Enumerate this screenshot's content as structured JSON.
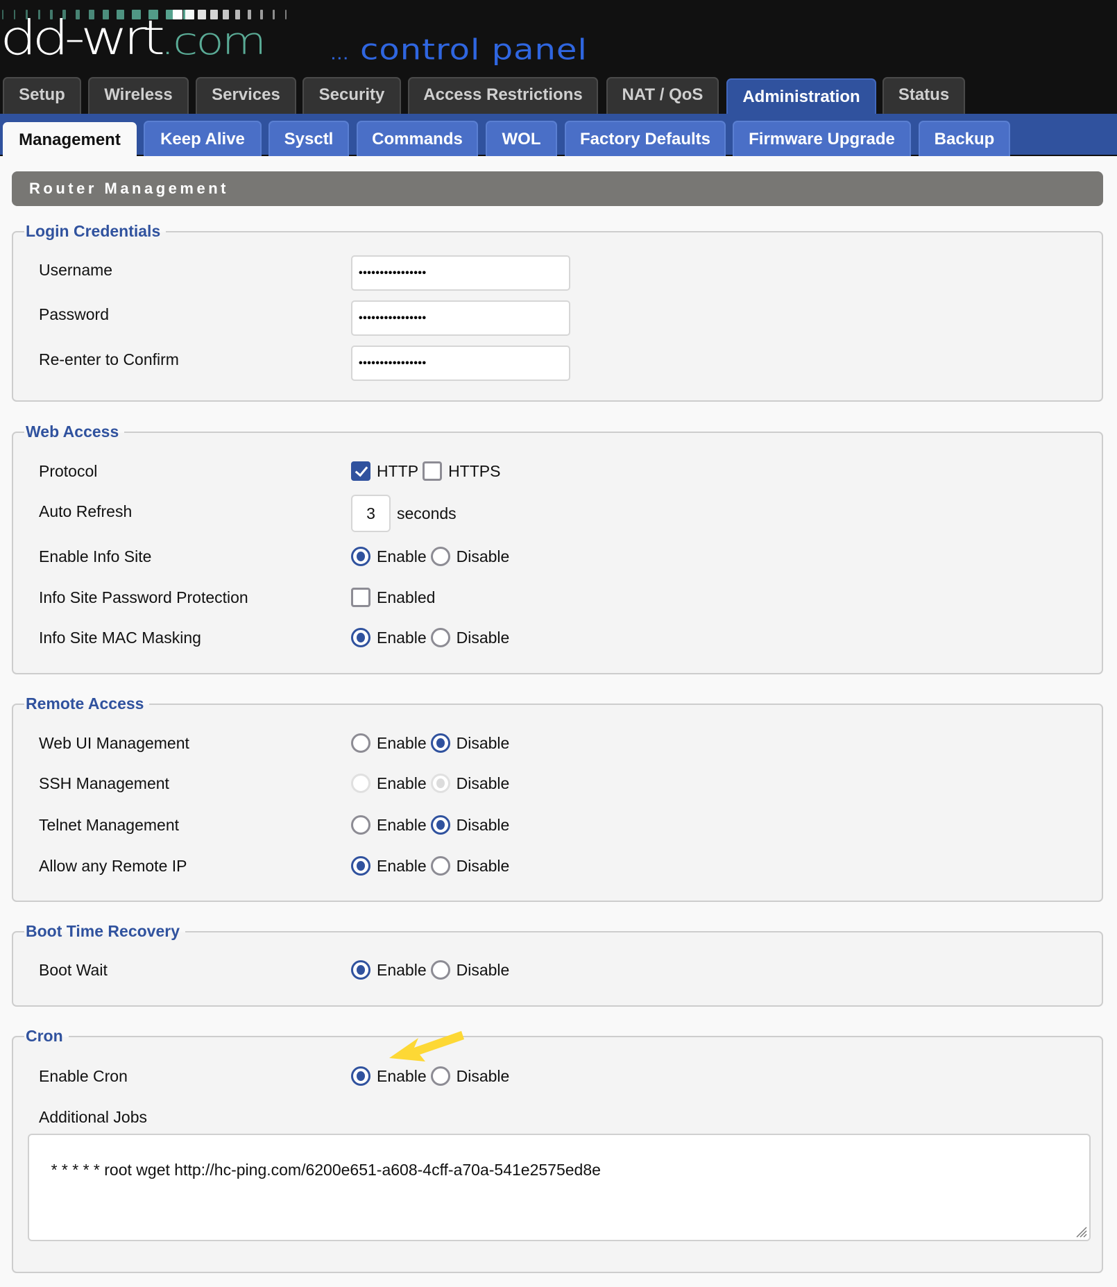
{
  "brand": {
    "logo_main": "dd-wrt",
    "logo_suffix": ".com",
    "tagline_dots": "...",
    "tagline": " control panel",
    "colors": {
      "header_bg": "#111111",
      "logo_teal": "#5aab96",
      "tagline_blue": "#2f66e0",
      "accent_blue": "#30529e",
      "subtab_blue": "#4a6fc7",
      "section_gray": "#787774",
      "annotation_yellow": "#fdd835"
    }
  },
  "nav": {
    "tabs": [
      {
        "label": "Setup",
        "active": false
      },
      {
        "label": "Wireless",
        "active": false
      },
      {
        "label": "Services",
        "active": false
      },
      {
        "label": "Security",
        "active": false
      },
      {
        "label": "Access Restrictions",
        "active": false
      },
      {
        "label": "NAT / QoS",
        "active": false
      },
      {
        "label": "Administration",
        "active": true
      },
      {
        "label": "Status",
        "active": false
      }
    ],
    "subtabs": [
      {
        "label": "Management",
        "active": true
      },
      {
        "label": "Keep Alive",
        "active": false
      },
      {
        "label": "Sysctl",
        "active": false
      },
      {
        "label": "Commands",
        "active": false
      },
      {
        "label": "WOL",
        "active": false
      },
      {
        "label": "Factory Defaults",
        "active": false
      },
      {
        "label": "Firmware Upgrade",
        "active": false
      },
      {
        "label": "Backup",
        "active": false
      }
    ]
  },
  "page": {
    "section_title": "Router Management"
  },
  "login_credentials": {
    "legend": "Login Credentials",
    "username_label": "Username",
    "username_value": "••••••••••••••••",
    "password_label": "Password",
    "password_value": "••••••••••••••••",
    "confirm_label": "Re-enter to Confirm",
    "confirm_value": "••••••••••••••••"
  },
  "web_access": {
    "legend": "Web Access",
    "protocol_label": "Protocol",
    "protocol_http_label": "HTTP",
    "protocol_http_checked": true,
    "protocol_https_label": "HTTPS",
    "protocol_https_checked": false,
    "auto_refresh_label": "Auto Refresh",
    "auto_refresh_value": "3",
    "auto_refresh_unit": "seconds",
    "info_site_label": "Enable Info Site",
    "info_site_value": "Enable",
    "info_pw_label": "Info Site Password Protection",
    "info_pw_option": "Enabled",
    "info_pw_checked": false,
    "mac_masking_label": "Info Site MAC Masking",
    "mac_masking_value": "Enable"
  },
  "remote_access": {
    "legend": "Remote Access",
    "webui_label": "Web UI Management",
    "webui_value": "Disable",
    "ssh_label": "SSH Management",
    "ssh_value": "Disable",
    "ssh_disabled": true,
    "telnet_label": "Telnet Management",
    "telnet_value": "Disable",
    "remote_ip_label": "Allow any Remote IP",
    "remote_ip_value": "Enable"
  },
  "boot_time_recovery": {
    "legend": "Boot Time Recovery",
    "boot_wait_label": "Boot Wait",
    "boot_wait_value": "Enable"
  },
  "cron": {
    "legend": "Cron",
    "enable_label": "Enable Cron",
    "enable_value": "Enable",
    "jobs_label": "Additional Jobs",
    "jobs_value": "* * * * * root wget http://hc-ping.com/6200e651-a608-4cff-a70a-541e2575ed8e"
  },
  "options": {
    "enable": "Enable",
    "disable": "Disable"
  }
}
